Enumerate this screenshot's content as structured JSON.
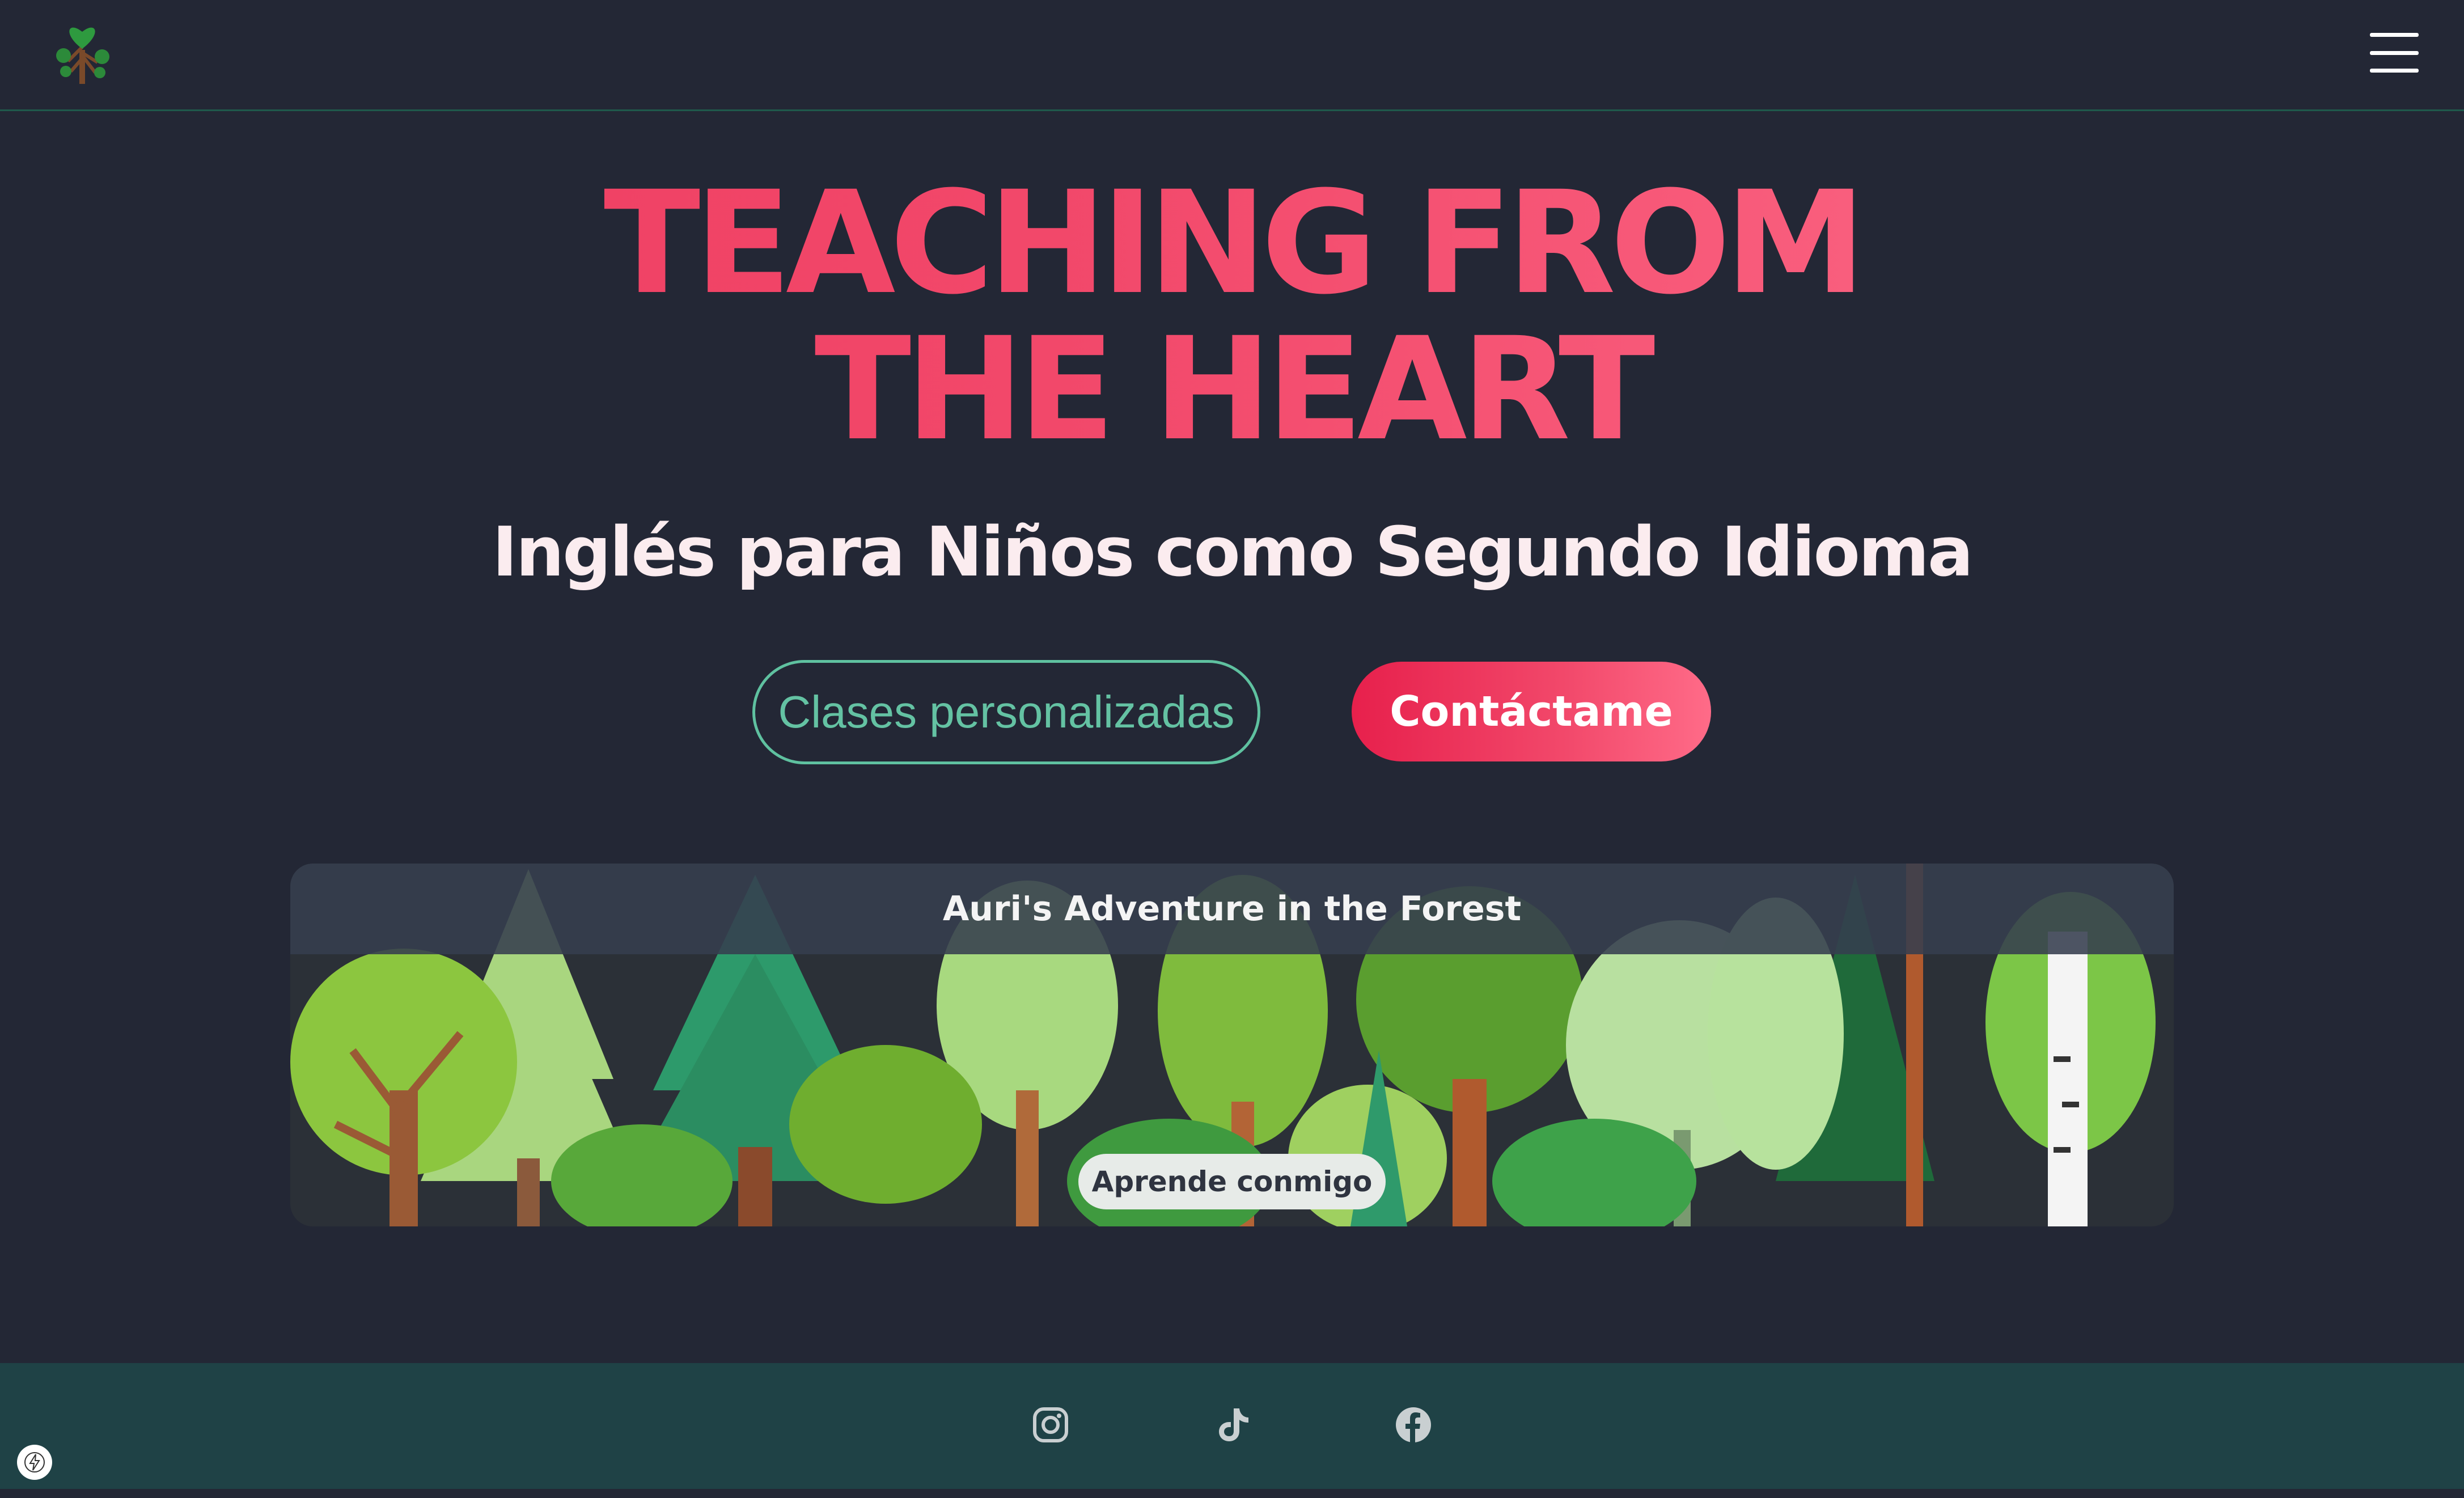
{
  "navbar": {
    "logo_icon": "heart-tree-logo",
    "menu_icon": "hamburger-menu-icon"
  },
  "hero": {
    "title_line1": "TEACHING FROM",
    "title_line2": "THE HEART",
    "subtitle": "Inglés para Niños como Segundo Idioma"
  },
  "actions": {
    "secondary_label": "Clases personalizadas",
    "primary_label": "Contáctame"
  },
  "banner": {
    "title": "Auri's Adventure in the Forest",
    "cta_label": "Aprende conmigo"
  },
  "footer": {
    "social": [
      "instagram-icon",
      "tiktok-icon",
      "facebook-icon"
    ]
  },
  "colors": {
    "background": "#232735",
    "accent_pink": "#f2496b",
    "accent_green": "#5fc1a0",
    "footer": "#1f4246"
  }
}
